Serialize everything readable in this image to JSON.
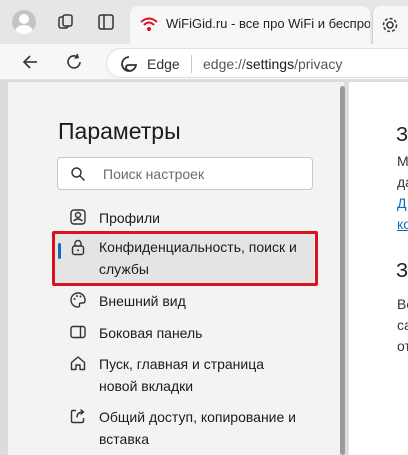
{
  "tab": {
    "title": "WiFiGid.ru - все про WiFi и беспроводные сети"
  },
  "address": {
    "edge_label": "Edge",
    "url_prefix": "edge://",
    "url_strong": "settings",
    "url_suffix": "/privacy"
  },
  "sidebar": {
    "heading": "Параметры",
    "search_placeholder": "Поиск настроек",
    "items": [
      {
        "icon": "profile-icon",
        "lines": [
          "Профили"
        ]
      },
      {
        "icon": "lock-icon",
        "lines": [
          "Конфиденциальность, поиск и",
          "службы"
        ],
        "active": true
      },
      {
        "icon": "palette-icon",
        "lines": [
          "Внешний вид"
        ]
      },
      {
        "icon": "sidebar-panel-icon",
        "lines": [
          "Боковая панель"
        ]
      },
      {
        "icon": "home-icon",
        "lines": [
          "Пуск, главная и страница",
          "новой вкладки"
        ]
      },
      {
        "icon": "share-icon",
        "lines": [
          "Общий доступ, копирование и",
          "вставка"
        ]
      }
    ]
  },
  "content": {
    "h1": "З",
    "lines1": [
      "М",
      "да"
    ],
    "links1": [
      "Д",
      "ко"
    ],
    "h2": "З",
    "lines2": [
      "Ве",
      "са",
      "от"
    ]
  },
  "colors": {
    "accent": "#0f6cbd",
    "highlight": "#d7141e",
    "wifi_icon": "#d7141e"
  }
}
